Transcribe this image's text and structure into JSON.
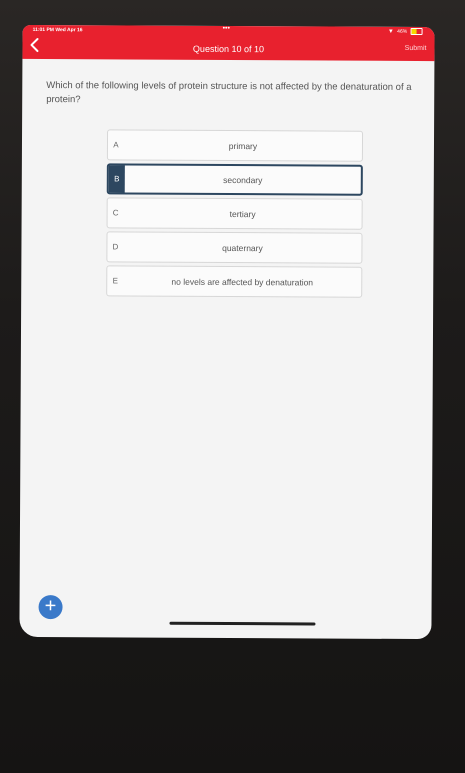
{
  "status": {
    "time": "11:01 PM  Wed Apr 16",
    "dots": "•••",
    "battery": "46%"
  },
  "header": {
    "title": "Question 10 of 10",
    "submit_label": "Submit"
  },
  "question": {
    "text": "Which of the following levels of protein structure is not affected by the denaturation of a protein?"
  },
  "choices": [
    {
      "letter": "A",
      "text": "primary",
      "selected": false
    },
    {
      "letter": "B",
      "text": "secondary",
      "selected": true
    },
    {
      "letter": "C",
      "text": "tertiary",
      "selected": false
    },
    {
      "letter": "D",
      "text": "quaternary",
      "selected": false
    },
    {
      "letter": "E",
      "text": "no levels are affected by denaturation",
      "selected": false
    }
  ],
  "fab": {
    "label": "+"
  },
  "colors": {
    "header": "#e8212e",
    "selected": "#2d4760",
    "fab": "#3a79c9"
  }
}
